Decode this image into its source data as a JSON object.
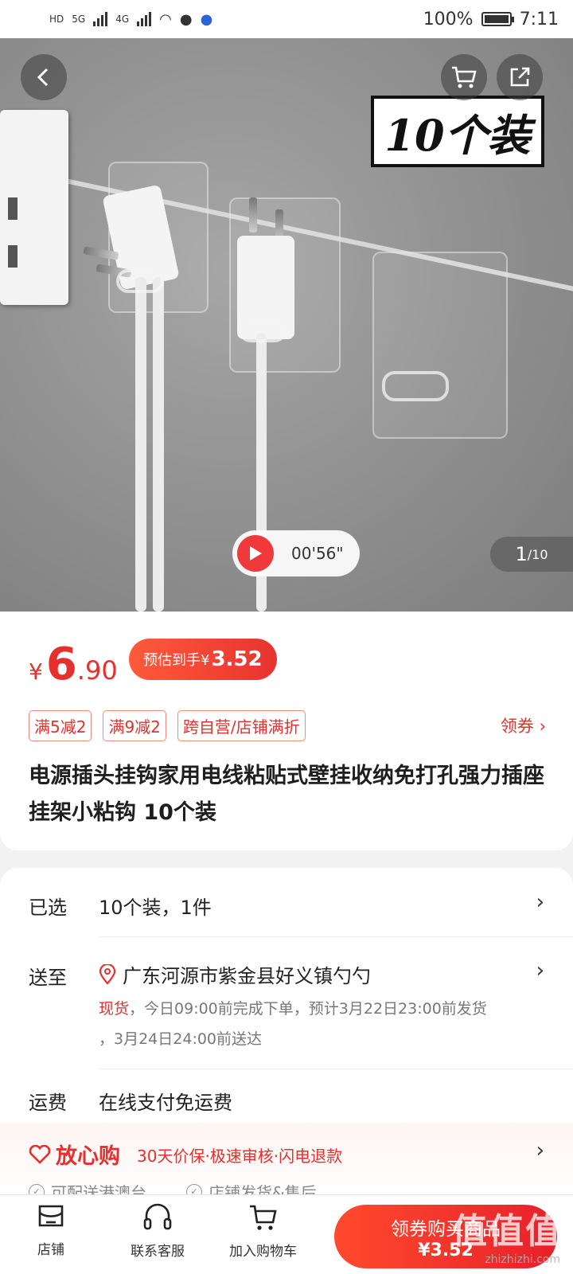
{
  "status_bar": {
    "sim_labels": [
      "HD",
      "HD"
    ],
    "network_1": "5G",
    "network_2": "4G",
    "battery": "100%",
    "battery_level": 1.0,
    "time": "7:11"
  },
  "hero": {
    "pack_label": "10个装",
    "video_duration": "00'56\"",
    "image_index": "1",
    "image_total": "/10",
    "icons": [
      "back-icon",
      "cart-icon",
      "share-icon",
      "play-icon"
    ]
  },
  "price": {
    "currency": "¥",
    "integer": "6",
    "decimal": ".90",
    "estimate_label": "预估到手¥",
    "estimate_value": "3.52"
  },
  "tags": [
    "满5减2",
    "满9减2",
    "跨自营/店铺满折"
  ],
  "coupon_label": "领券 ›",
  "title": "电源插头挂钩家用电线粘贴式壁挂收纳免打孔强力插座挂架小粘钩 10个装",
  "selected": {
    "label": "已选",
    "value": "10个装，1件"
  },
  "ship_to": {
    "label": "送至",
    "address": "广东河源市紫金县好义镇勺勺",
    "stock": "现货",
    "detail_line1": "，今日09:00前完成下单，预计3月22日23:00前发货",
    "detail_line2": "，3月24日24:00前送达"
  },
  "freight": {
    "label": "运费",
    "value": "在线支付免运费"
  },
  "assurance": {
    "brand": "放心购",
    "text": "30天价保·极速审核·闪电退款",
    "items": [
      "可配送港澳台",
      "店铺发货&售后"
    ]
  },
  "bottom_bar": {
    "store": "店铺",
    "service": "联系客服",
    "add_cart": "加入购物车",
    "buy_label": "领券购买商品",
    "buy_price": "¥3.52"
  },
  "watermark": {
    "main": "值值值",
    "sub": "zhizhizhi.com"
  },
  "colors": {
    "accent": "#e5302d",
    "buy_gradient_start": "#ff4a2d",
    "buy_gradient_end": "#e8202a"
  }
}
